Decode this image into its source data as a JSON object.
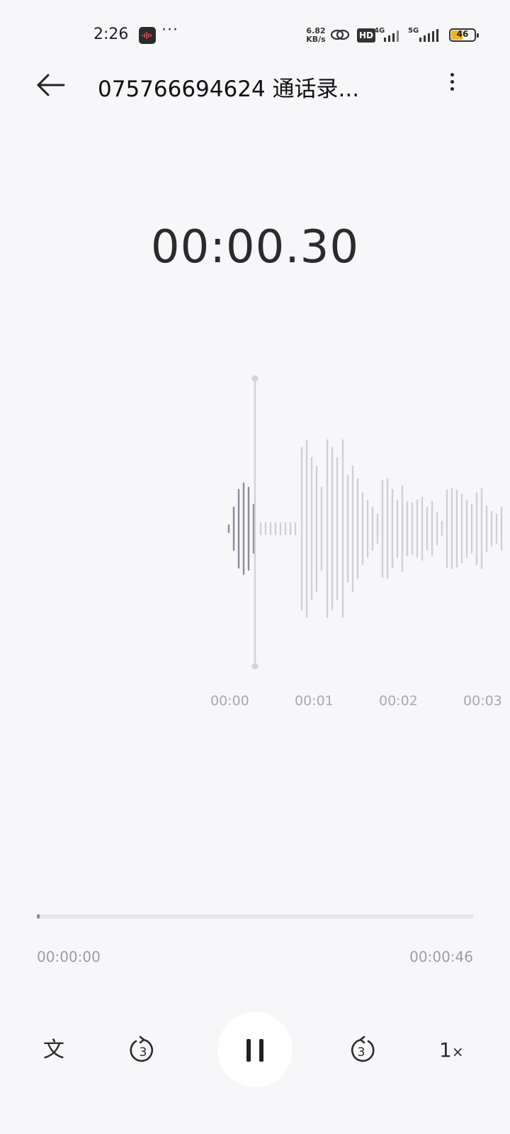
{
  "status_bar": {
    "time": "2:26",
    "more": "···",
    "net_speed_value": "6.82",
    "net_speed_unit": "KB/s",
    "hd_label": "HD",
    "net1": "4G",
    "net2": "5G",
    "battery_level": "46",
    "battery_color": "#f2b21f"
  },
  "header": {
    "title": "075766694624 通话录...",
    "back_icon": "arrow-left-icon",
    "menu_icon": "more-vertical-icon"
  },
  "timer": "00:00.30",
  "waveform": {
    "timeline_labels": [
      "00:00",
      "00:01",
      "00:02",
      "00:03"
    ],
    "played_color": "#8a8d99",
    "unplayed_color": "#cfd0d6",
    "playhead_color": "#d4d4d8"
  },
  "playback": {
    "elapsed": "00:00:00",
    "duration": "00:00:46",
    "progress_fraction": 0.007
  },
  "controls": {
    "transcribe_label": "文",
    "rewind_seconds": "3",
    "forward_seconds": "3",
    "speed_value": "1",
    "speed_suffix": "×",
    "play_state_icon": "pause-icon"
  }
}
